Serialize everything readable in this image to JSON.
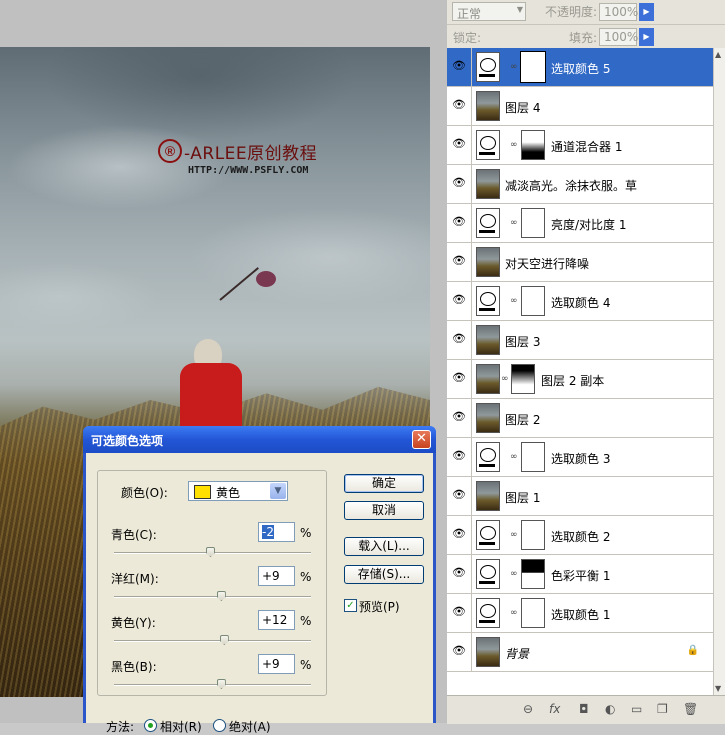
{
  "canvas": {
    "logo_mark": "®",
    "logo_title": "-ARLEE原创教程",
    "logo_url": "HTTP://WWW.PSFLY.COM"
  },
  "dialog": {
    "title": "可选颜色选项",
    "close_label": "✕",
    "color_label": "颜色(O):",
    "color_value": "黄色",
    "color_swatch": "#ffe000",
    "sliders": [
      {
        "label": "青色(C):",
        "value": "-2",
        "percent": -2
      },
      {
        "label": "洋红(M):",
        "value": "+9",
        "percent": 9
      },
      {
        "label": "黄色(Y):",
        "value": "+12",
        "percent": 12
      },
      {
        "label": "黑色(B):",
        "value": "+9",
        "percent": 9
      }
    ],
    "pct_sign": "%",
    "ok": "确定",
    "cancel": "取消",
    "load": "载入(L)...",
    "save": "存储(S)...",
    "preview": "预览(P)",
    "preview_checked": true,
    "method_label": "方法:",
    "method_relative": "相对(R)",
    "method_absolute": "绝对(A)",
    "method_selected": "relative"
  },
  "panel": {
    "blend_mode": "正常",
    "opacity_label": "不透明度:",
    "opacity_value": "100%",
    "lock_label": "锁定:",
    "fill_label": "填充:",
    "fill_value": "100%",
    "layers": [
      {
        "name": "选取颜色 5",
        "type": "adjustment",
        "selected": true
      },
      {
        "name": "图层 4",
        "type": "photo"
      },
      {
        "name": "通道混合器 1",
        "type": "mixer"
      },
      {
        "name": "减淡高光。涂抹衣服。草",
        "type": "photo"
      },
      {
        "name": "亮度/对比度 1",
        "type": "brightness"
      },
      {
        "name": "对天空进行降噪",
        "type": "photo"
      },
      {
        "name": "选取颜色 4",
        "type": "adjustment"
      },
      {
        "name": "图层 3",
        "type": "photo"
      },
      {
        "name": "图层 2 副本",
        "type": "photo-mask"
      },
      {
        "name": "图层 2",
        "type": "photo"
      },
      {
        "name": "选取颜色 3",
        "type": "adjustment"
      },
      {
        "name": "图层 1",
        "type": "photo"
      },
      {
        "name": "选取颜色 2",
        "type": "adjustment"
      },
      {
        "name": "色彩平衡 1",
        "type": "balance"
      },
      {
        "name": "选取颜色 1",
        "type": "adjustment"
      },
      {
        "name": "背景",
        "type": "background"
      }
    ],
    "bottom_icons": [
      "link-icon",
      "fx-icon",
      "mask-icon",
      "adjustment-icon",
      "folder-icon",
      "new-layer-icon",
      "trash-icon"
    ]
  }
}
